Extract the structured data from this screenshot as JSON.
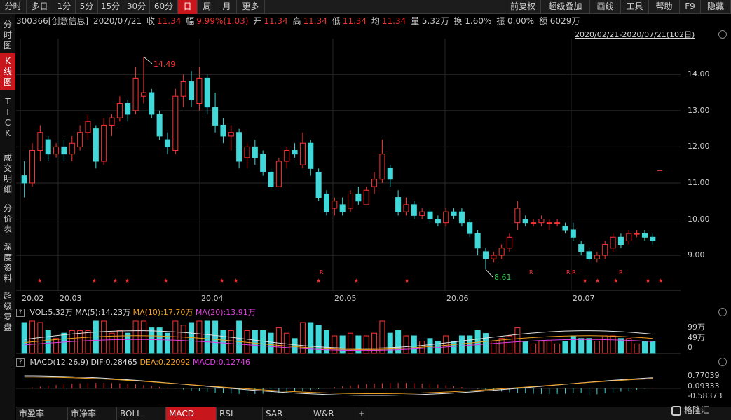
{
  "period_tabs": [
    "分时",
    "多日",
    "1分",
    "5分",
    "15分",
    "30分",
    "60分",
    "日",
    "周",
    "月",
    "更多"
  ],
  "active_period": "日",
  "toolbar_right": [
    "前复权",
    "超级叠加",
    "画线",
    "工具",
    "帮助",
    "F9",
    "隐藏"
  ],
  "left_tabs": [
    "分\n时\n图",
    "K\n线\n图",
    "T\nI\nC\nK",
    "成\n交\n明\n细",
    "分\n价\n表",
    "深\n度\n资\n料",
    "超\n级\n复\n盘"
  ],
  "active_left_tab": "K\n线\n图",
  "info": {
    "code": "300366[创意信息]",
    "date": "2020/07/21",
    "close_label": "收",
    "close": "11.34",
    "change_label": "幅",
    "change": "9.99%(1.03)",
    "open_label": "开",
    "open": "11.34",
    "high_label": "高",
    "high": "11.34",
    "low_label": "低",
    "low": "11.34",
    "avg_label": "均",
    "avg": "11.34",
    "volume": "量 5.32万",
    "turnover": "换 1.60%",
    "amplitude": "振 0.00%",
    "amount": "额 6029万"
  },
  "range_label": "2020/02/21-2020/07/21(102日)",
  "chart_data": {
    "type": "candlestick",
    "y_ticks": [
      "14.00",
      "13.00",
      "12.00",
      "11.00",
      "10.00",
      "9.00"
    ],
    "ylim": [
      8.4,
      14.8
    ],
    "x_ticks": [
      "20.02",
      "20.03",
      "20.04",
      "20.05",
      "20.06",
      "20.07"
    ],
    "annotations": [
      {
        "label": "14.49"
      },
      {
        "label": "8.61"
      }
    ],
    "marker_star": "★",
    "marker_r": "R",
    "candles": [
      [
        11.2,
        11.6,
        10.6,
        11.0
      ],
      [
        11.0,
        12.1,
        10.9,
        11.9
      ],
      [
        11.9,
        12.6,
        11.6,
        12.4
      ],
      [
        12.2,
        12.3,
        11.6,
        11.8
      ],
      [
        11.8,
        12.1,
        11.7,
        12.0
      ],
      [
        12.0,
        12.2,
        11.6,
        11.8
      ],
      [
        11.8,
        12.3,
        11.6,
        12.1
      ],
      [
        12.0,
        12.6,
        11.9,
        12.4
      ],
      [
        12.4,
        12.9,
        12.2,
        12.7
      ],
      [
        12.5,
        12.6,
        11.4,
        11.6
      ],
      [
        11.6,
        12.8,
        11.5,
        12.6
      ],
      [
        12.6,
        12.9,
        12.3,
        12.8
      ],
      [
        12.8,
        13.4,
        12.7,
        13.2
      ],
      [
        13.2,
        13.3,
        12.7,
        12.9
      ],
      [
        13.0,
        14.2,
        12.9,
        13.9
      ],
      [
        13.4,
        14.49,
        13.2,
        13.5
      ],
      [
        13.5,
        13.6,
        12.8,
        12.9
      ],
      [
        12.9,
        13.0,
        12.2,
        12.3
      ],
      [
        12.2,
        12.4,
        11.8,
        12.0
      ],
      [
        11.9,
        13.6,
        11.8,
        13.4
      ],
      [
        13.4,
        14.0,
        13.1,
        13.8
      ],
      [
        13.8,
        14.1,
        13.1,
        13.3
      ],
      [
        13.2,
        14.2,
        13.0,
        13.9
      ],
      [
        13.9,
        14.0,
        12.9,
        13.1
      ],
      [
        13.1,
        13.5,
        12.4,
        12.6
      ],
      [
        12.6,
        12.8,
        12.1,
        12.3
      ],
      [
        12.3,
        12.6,
        11.9,
        12.4
      ],
      [
        12.4,
        12.5,
        11.4,
        11.6
      ],
      [
        11.7,
        12.1,
        11.4,
        12.0
      ],
      [
        12.0,
        12.2,
        11.5,
        11.7
      ],
      [
        11.8,
        11.9,
        11.2,
        11.3
      ],
      [
        11.3,
        11.4,
        10.8,
        10.9
      ],
      [
        10.9,
        11.7,
        10.9,
        11.6
      ],
      [
        11.6,
        12.0,
        11.4,
        11.9
      ],
      [
        11.9,
        12.1,
        11.7,
        11.8
      ],
      [
        11.5,
        12.4,
        11.4,
        12.1
      ],
      [
        12.1,
        12.2,
        11.2,
        11.4
      ],
      [
        11.3,
        11.4,
        10.5,
        10.6
      ],
      [
        10.7,
        10.8,
        10.1,
        10.2
      ],
      [
        10.3,
        10.6,
        10.1,
        10.5
      ],
      [
        10.4,
        10.6,
        10.1,
        10.2
      ],
      [
        10.3,
        10.8,
        10.2,
        10.7
      ],
      [
        10.7,
        10.9,
        10.4,
        10.5
      ],
      [
        10.4,
        10.9,
        10.4,
        10.8
      ],
      [
        10.9,
        11.3,
        10.7,
        11.1
      ],
      [
        11.1,
        12.2,
        11.0,
        11.8
      ],
      [
        11.4,
        11.5,
        10.9,
        11.1
      ],
      [
        10.6,
        10.8,
        10.1,
        10.2
      ],
      [
        10.2,
        10.6,
        10.1,
        10.4
      ],
      [
        10.4,
        10.5,
        10.0,
        10.1
      ],
      [
        10.1,
        10.3,
        10.0,
        10.2
      ],
      [
        10.2,
        10.3,
        9.9,
        10.0
      ],
      [
        10.0,
        10.1,
        9.8,
        9.9
      ],
      [
        9.9,
        10.3,
        9.8,
        10.2
      ],
      [
        10.2,
        10.3,
        10.0,
        10.1
      ],
      [
        10.2,
        10.3,
        9.8,
        9.9
      ],
      [
        9.9,
        10.0,
        9.5,
        9.6
      ],
      [
        9.6,
        9.7,
        9.0,
        9.2
      ],
      [
        9.1,
        9.2,
        8.61,
        8.9
      ],
      [
        8.9,
        9.1,
        8.8,
        9.0
      ],
      [
        9.0,
        9.3,
        8.9,
        9.2
      ],
      [
        9.2,
        9.6,
        9.1,
        9.5
      ],
      [
        9.9,
        10.5,
        9.7,
        10.3
      ],
      [
        10.0,
        10.1,
        9.8,
        9.9
      ],
      [
        9.9,
        10.0,
        9.8,
        9.9
      ],
      [
        9.9,
        10.1,
        9.8,
        10.0
      ],
      [
        9.9,
        10.0,
        9.7,
        9.9
      ],
      [
        9.9,
        10.0,
        9.8,
        9.9
      ],
      [
        9.8,
        9.9,
        9.6,
        9.7
      ],
      [
        9.7,
        9.9,
        9.4,
        9.5
      ],
      [
        9.3,
        9.4,
        9.0,
        9.1
      ],
      [
        9.1,
        9.2,
        8.8,
        8.9
      ],
      [
        8.9,
        9.1,
        8.8,
        9.0
      ],
      [
        9.0,
        9.4,
        8.9,
        9.3
      ],
      [
        9.2,
        9.6,
        9.1,
        9.5
      ],
      [
        9.5,
        9.6,
        9.2,
        9.3
      ],
      [
        9.4,
        9.7,
        9.3,
        9.6
      ],
      [
        9.6,
        9.7,
        9.5,
        9.6
      ],
      [
        9.6,
        9.7,
        9.4,
        9.5
      ],
      [
        9.5,
        9.6,
        9.3,
        9.4
      ]
    ],
    "volume": {
      "label": "VOL:5.32万",
      "ma5": "MA(5):14.23万",
      "ma10": "MA(10):17.70万",
      "ma20": "MA(20):13.91万",
      "y_ticks": [
        "99万",
        "49万",
        "0"
      ]
    },
    "macd": {
      "label": "MACD(12,26,9)",
      "dif": "DIF:0.28465",
      "dea": "DEA:0.22092",
      "macd": "MACD:0.12746",
      "y_ticks": [
        "0.77039",
        "0.09333",
        "-0.58373"
      ]
    }
  },
  "bottom_tabs": [
    "市盈率",
    "市净率",
    "BOLL",
    "MACD",
    "RSI",
    "SAR",
    "W&R",
    "+"
  ],
  "active_bottom_tab": "MACD",
  "logo_text": "格隆汇"
}
